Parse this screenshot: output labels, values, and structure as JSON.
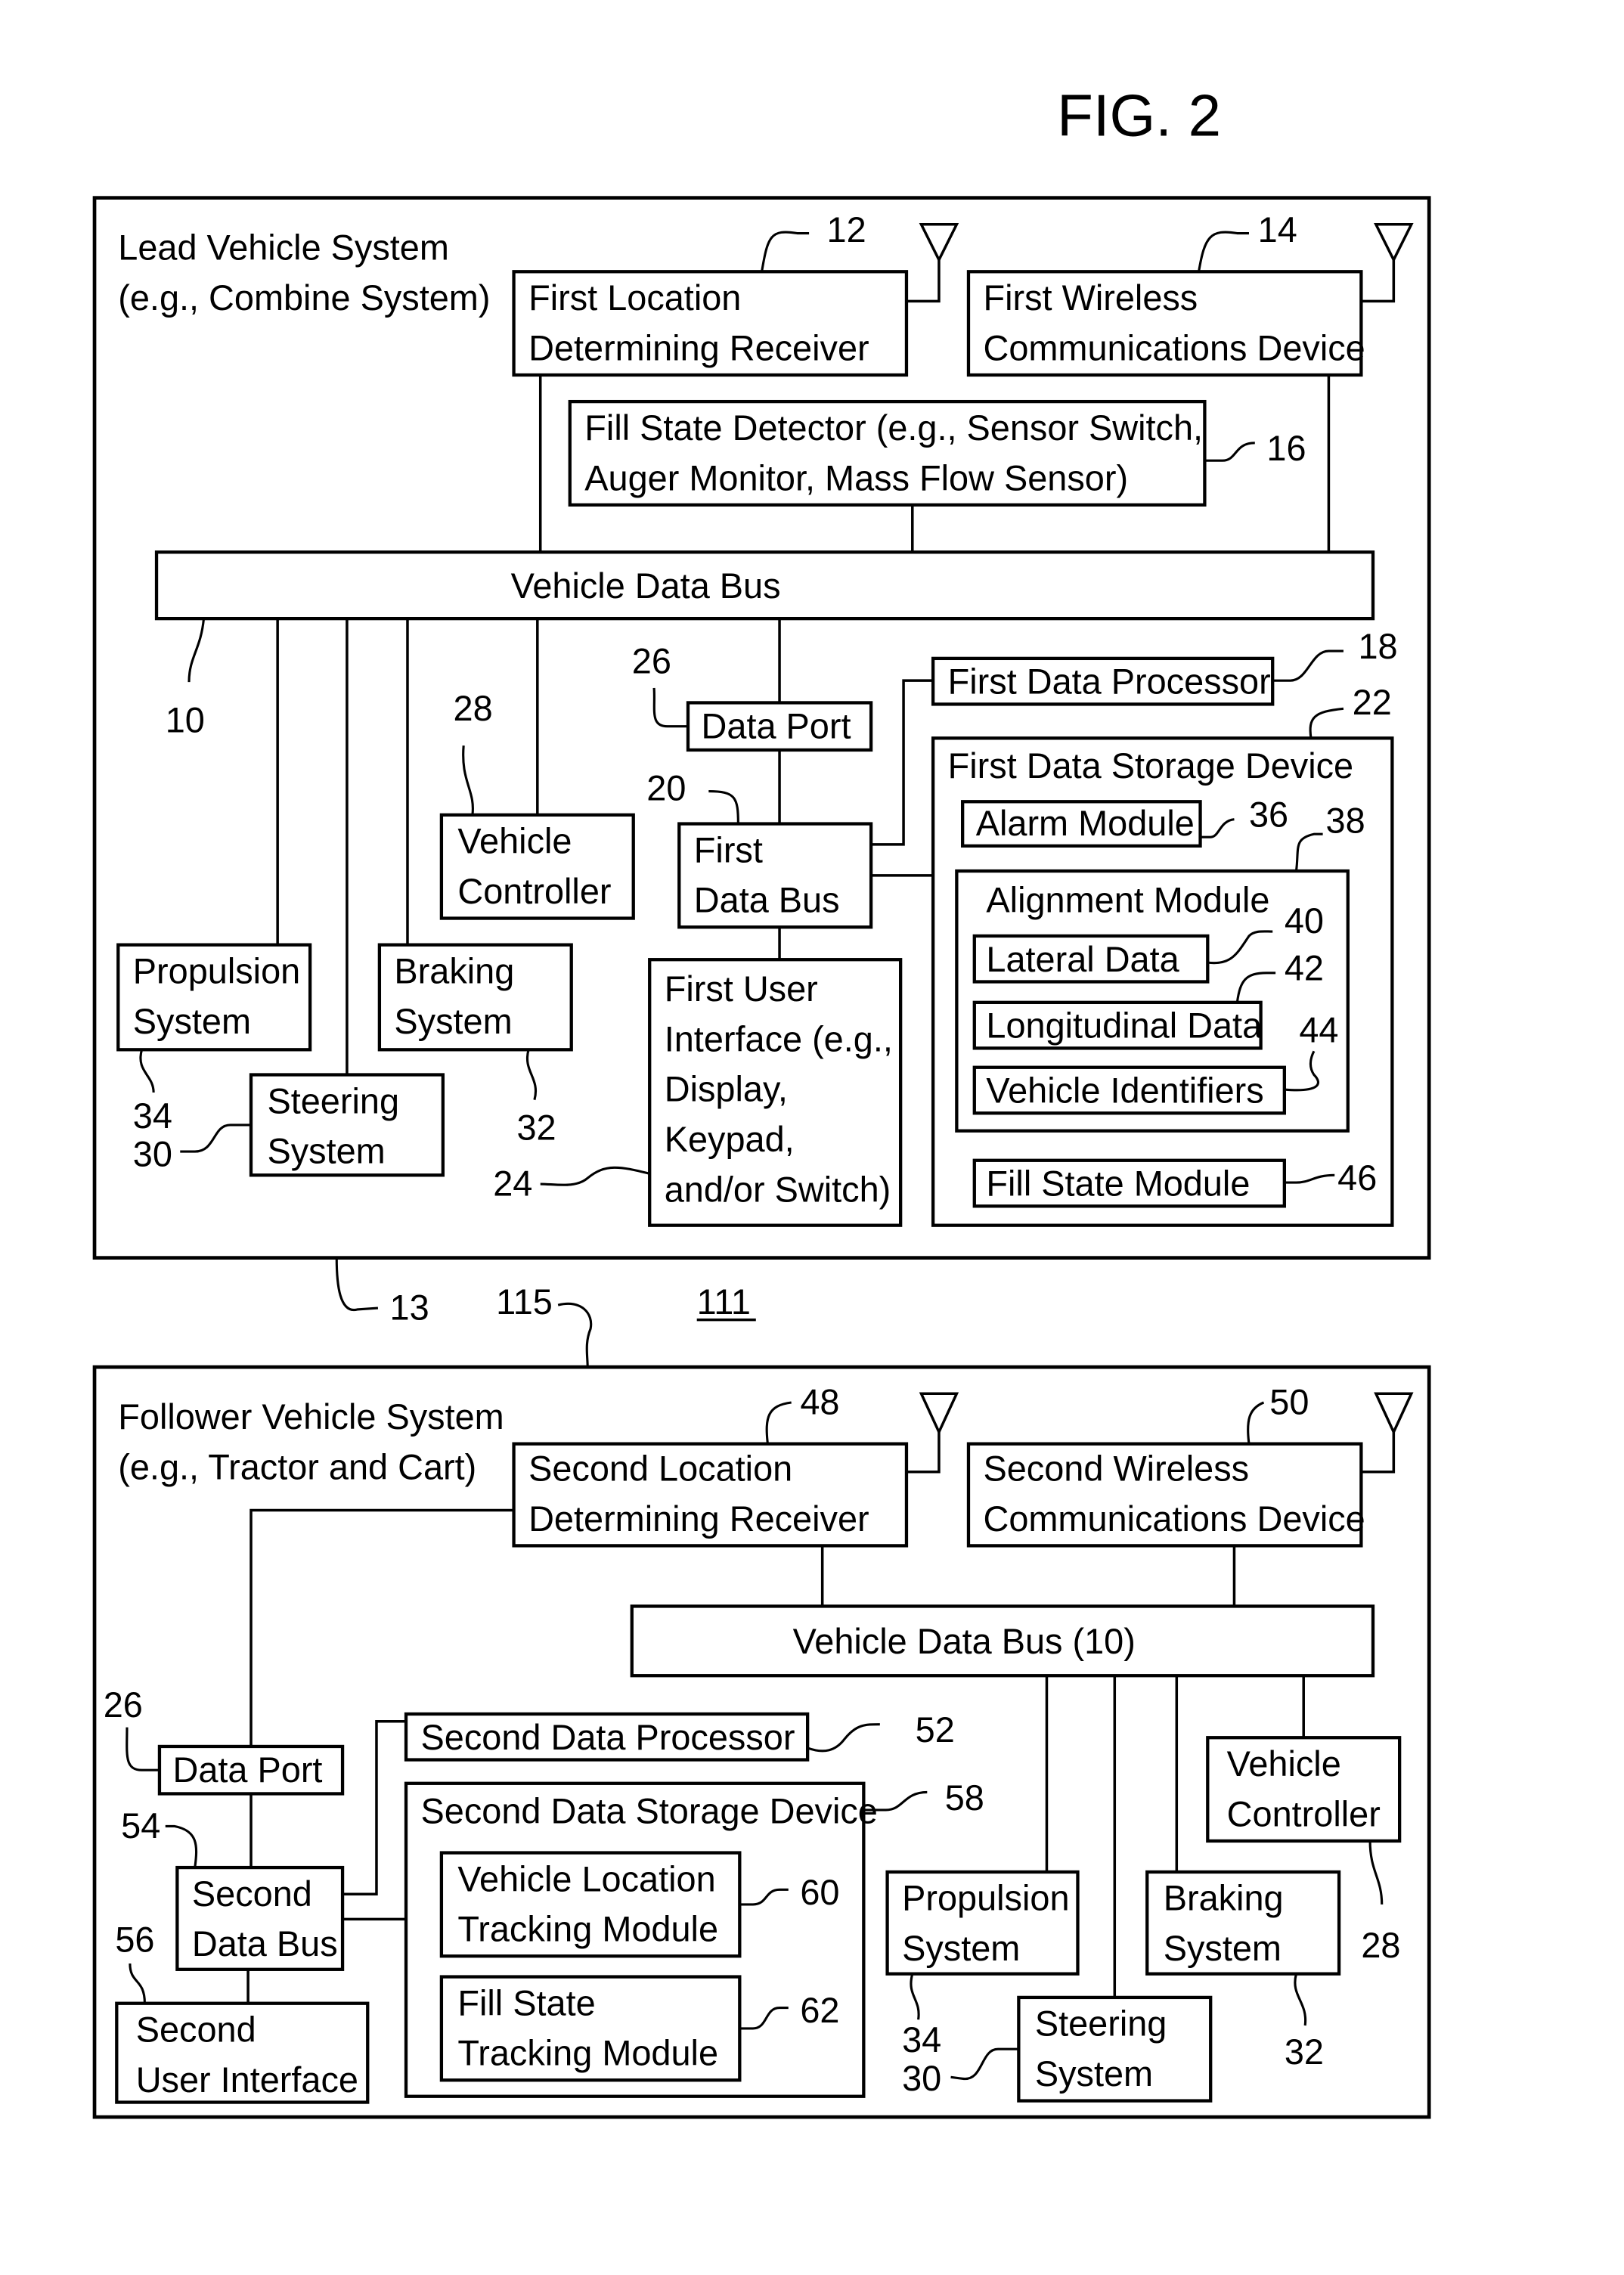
{
  "figure": {
    "title": "FIG. 2",
    "ref": "111"
  },
  "lead": {
    "title": [
      "Lead Vehicle System",
      "(e.g., Combine System)"
    ],
    "first_location": {
      "lines": [
        "First Location",
        "Determining Receiver"
      ],
      "ref": "12"
    },
    "first_wireless": {
      "lines": [
        "First Wireless",
        "Communications Device"
      ],
      "ref": "14"
    },
    "fill_state_detector": {
      "lines": [
        "Fill State Detector  (e.g., Sensor Switch,",
        "Auger Monitor, Mass Flow Sensor)"
      ],
      "ref": "16"
    },
    "vehicle_data_bus": {
      "label": "Vehicle Data Bus",
      "ref": "10"
    },
    "first_data_processor": {
      "label": "First Data Processor",
      "ref": "18"
    },
    "data_port": {
      "label": "Data Port",
      "ref": "26"
    },
    "first_data_bus": {
      "lines": [
        "First",
        "Data Bus"
      ],
      "ref": "20"
    },
    "first_data_storage": {
      "label": "First Data Storage Device",
      "ref": "22"
    },
    "alarm_module": {
      "label": "Alarm Module",
      "ref": "36"
    },
    "alignment_module": {
      "label": "Alignment Module",
      "ref": "38"
    },
    "lateral_data": {
      "label": "Lateral Data",
      "ref": "40"
    },
    "longitudinal_data": {
      "label": "Longitudinal Data",
      "ref": "42"
    },
    "vehicle_identifiers": {
      "label": "Vehicle Identifiers",
      "ref": "44"
    },
    "fill_state_module": {
      "label": "Fill State Module",
      "ref": "46"
    },
    "vehicle_controller": {
      "lines": [
        "Vehicle",
        "Controller"
      ],
      "ref": "28"
    },
    "propulsion": {
      "lines": [
        "Propulsion",
        "System"
      ],
      "ref": "34"
    },
    "braking": {
      "lines": [
        "Braking",
        "System"
      ],
      "ref": "32"
    },
    "steering": {
      "lines": [
        "Steering",
        "System"
      ],
      "ref": "30"
    },
    "first_user_interface": {
      "lines": [
        "First User",
        "Interface (e.g.,",
        "Display,",
        "Keypad,",
        "and/or Switch)"
      ],
      "ref": "24"
    }
  },
  "link": {
    "ref_13": "13",
    "ref_115": "115"
  },
  "follower": {
    "title": [
      "Follower Vehicle System",
      "(e.g., Tractor and Cart)"
    ],
    "second_location": {
      "lines": [
        "Second Location",
        "Determining Receiver"
      ],
      "ref": "48"
    },
    "second_wireless": {
      "lines": [
        "Second Wireless",
        "Communications Device"
      ],
      "ref": "50"
    },
    "vehicle_data_bus": {
      "label": "Vehicle Data Bus (10)"
    },
    "data_port": {
      "label": "Data Port",
      "ref": "26"
    },
    "second_data_processor": {
      "label": "Second Data Processor",
      "ref": "52"
    },
    "second_data_storage": {
      "label": "Second Data Storage Device",
      "ref": "58"
    },
    "second_data_bus": {
      "lines": [
        "Second",
        "Data Bus"
      ],
      "ref": "54"
    },
    "vehicle_location_tracking": {
      "lines": [
        "Vehicle Location",
        "Tracking Module"
      ],
      "ref": "60"
    },
    "fill_state_tracking": {
      "lines": [
        "Fill State",
        "Tracking Module"
      ],
      "ref": "62"
    },
    "second_user_interface": {
      "lines": [
        "Second",
        "User Interface"
      ],
      "ref": "56"
    },
    "vehicle_controller": {
      "lines": [
        "Vehicle",
        "Controller"
      ],
      "ref": "28"
    },
    "propulsion": {
      "lines": [
        "Propulsion",
        "System"
      ],
      "ref": "34"
    },
    "braking": {
      "lines": [
        "Braking",
        "System"
      ],
      "ref": "32"
    },
    "steering": {
      "lines": [
        "Steering",
        "System"
      ],
      "ref": "30"
    }
  }
}
